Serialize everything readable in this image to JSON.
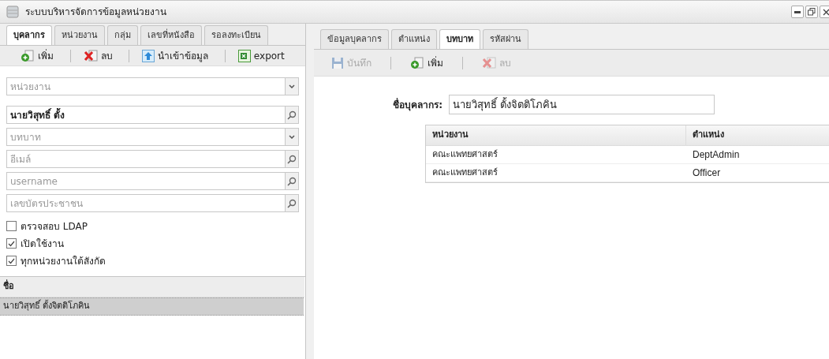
{
  "window": {
    "title": "ระบบบริหารจัดการข้อมูลหน่วยงาน"
  },
  "tabs": [
    {
      "label": "บุคลากร",
      "selected": true
    },
    {
      "label": "หน่วยงาน",
      "selected": false
    },
    {
      "label": "กลุ่ม",
      "selected": false
    },
    {
      "label": "เลขที่หนังสือ",
      "selected": false
    },
    {
      "label": "รอลงทะเบียน",
      "selected": false
    }
  ],
  "left_toolbar": [
    {
      "kind": "add",
      "label": "เพิ่ม"
    },
    {
      "kind": "delete",
      "label": "ลบ"
    },
    {
      "kind": "import",
      "label": "นำเข้าข้อมูล"
    },
    {
      "kind": "export",
      "label": "export"
    }
  ],
  "filters": [
    {
      "kind": "select",
      "placeholder": "หน่วยงาน"
    },
    {
      "kind": "search",
      "value": "นายวิสุทธิ์ ตั้ง"
    },
    {
      "kind": "select",
      "placeholder": "บทบาท"
    },
    {
      "kind": "search",
      "placeholder": "อีเมล์"
    },
    {
      "kind": "search",
      "placeholder": "username"
    },
    {
      "kind": "search",
      "placeholder": "เลขบัตรประชาชน"
    }
  ],
  "checkboxes": [
    {
      "label": "ตรวจสอบ LDAP",
      "checked": false
    },
    {
      "label": "เปิดใช้งาน",
      "checked": true
    },
    {
      "label": "ทุกหน่วยงานใต้สังกัด",
      "checked": true
    }
  ],
  "people_list": {
    "column": "ชื่อ",
    "rows": [
      {
        "name": "นายวิสุทธิ์ ตั้งจิตติโภคิน",
        "selected": true
      }
    ]
  },
  "detail_tabs": [
    {
      "label": "ข้อมูลบุคลากร",
      "selected": false
    },
    {
      "label": "ตำแหน่ง",
      "selected": false
    },
    {
      "label": "บทบาท",
      "selected": true
    },
    {
      "label": "รหัสผ่าน",
      "selected": false
    }
  ],
  "detail_toolbar": [
    {
      "kind": "save",
      "label": "บันทึก",
      "disabled": true
    },
    {
      "kind": "add",
      "label": "เพิ่ม",
      "disabled": false
    },
    {
      "kind": "delete",
      "label": "ลบ",
      "disabled": true
    }
  ],
  "person_field": {
    "label": "ชื่อบุคลากร:",
    "value": "นายวิสุทธิ์ ตั้งจิตติโภคิน"
  },
  "roles_table": {
    "columns": [
      "หน่วยงาน",
      "ตำแหน่ง"
    ],
    "rows": [
      [
        "คณะแพทยศาสตร์",
        "DeptAdmin"
      ],
      [
        "คณะแพทยศาสตร์",
        "Officer"
      ]
    ]
  }
}
